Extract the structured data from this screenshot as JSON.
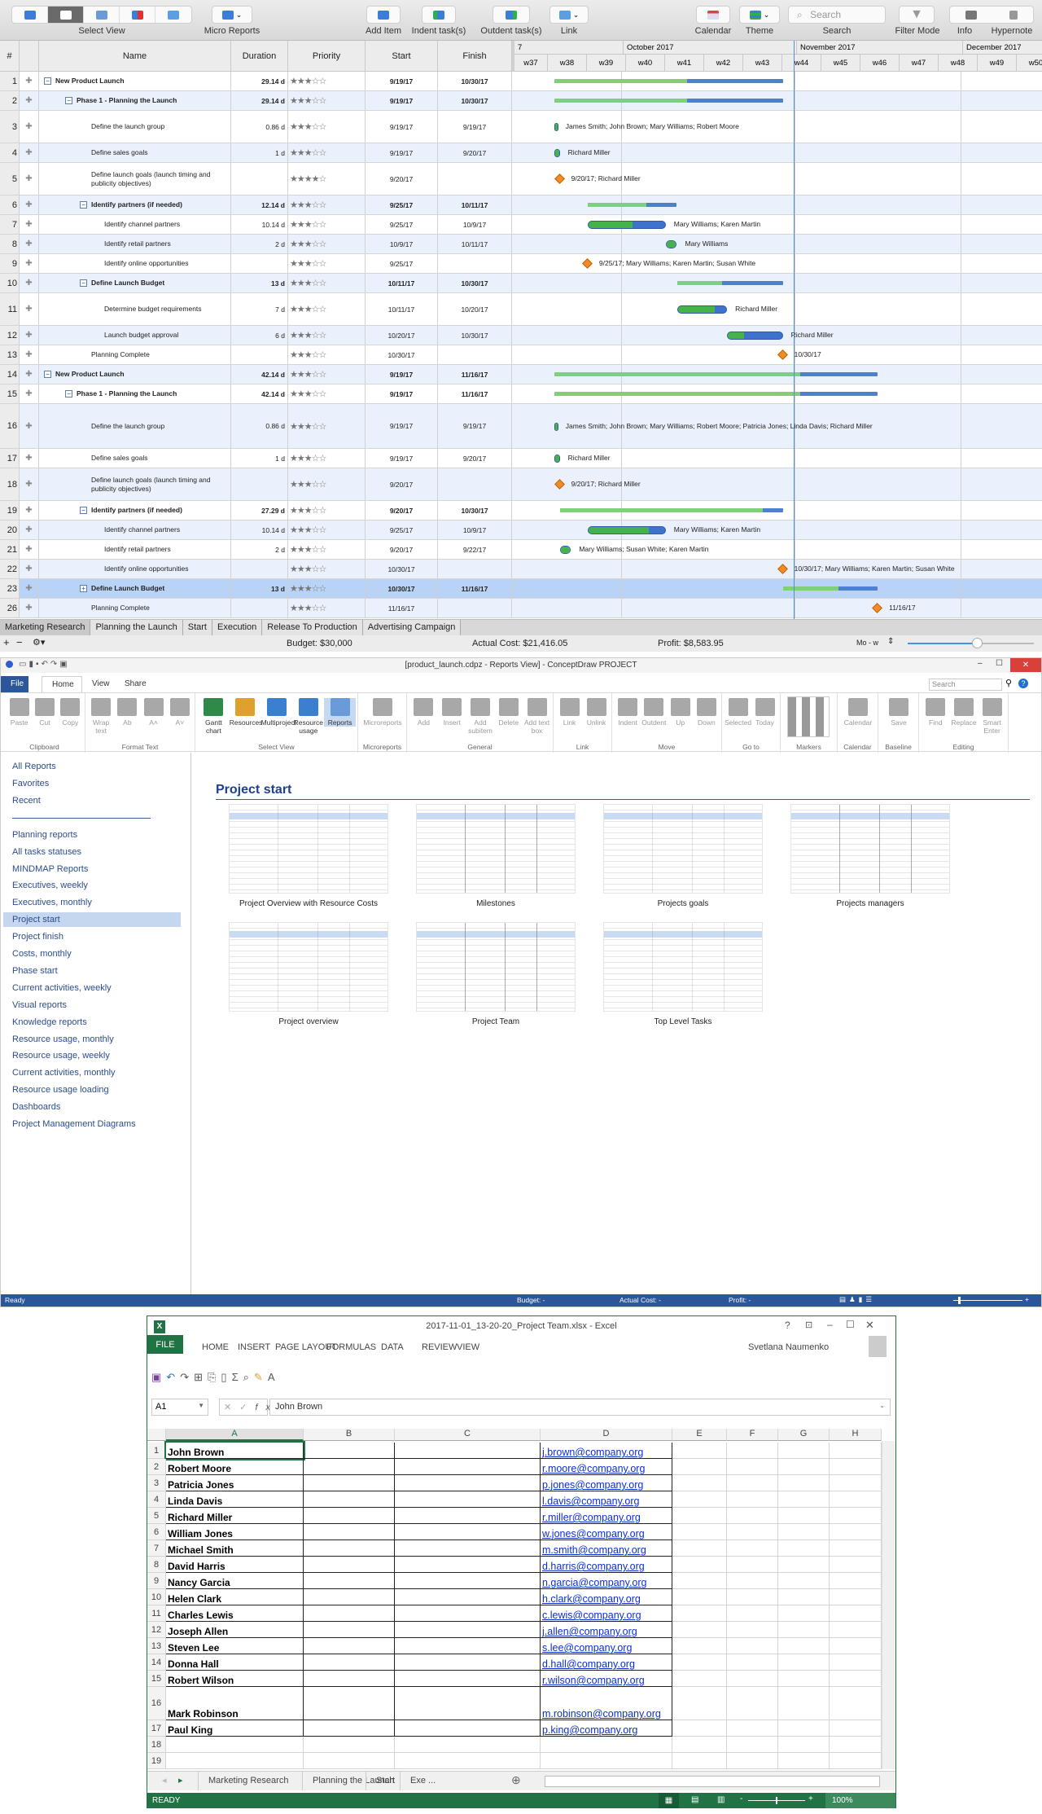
{
  "mac_app": {
    "toolbar": {
      "select_view_label": "Select View",
      "micro_reports_label": "Micro Reports",
      "add_item": "Add Item",
      "indent": "Indent task(s)",
      "outdent": "Outdent task(s)",
      "link": "Link",
      "calendar": "Calendar",
      "theme": "Theme",
      "search_placeholder": "Search",
      "search_label": "Search",
      "filter_mode": "Filter Mode",
      "info": "Info",
      "hypernote": "Hypernote"
    },
    "columns": {
      "num": "#",
      "name": "Name",
      "duration": "Duration",
      "priority": "Priority",
      "start": "Start",
      "finish": "Finish"
    },
    "timeline": {
      "months": [
        "7",
        "October 2017",
        "November 2017",
        "December 2017"
      ],
      "weeks": [
        "w37",
        "w38",
        "w39",
        "w40",
        "w41",
        "w42",
        "w43",
        "w44",
        "w45",
        "w46",
        "w47",
        "w48",
        "w49",
        "w50"
      ],
      "today": "11/1/17"
    },
    "tasks": [
      {
        "n": "1",
        "name": "New Product Launch",
        "lvl": 0,
        "bold": true,
        "tog": "−",
        "dur": "29.14 d",
        "stars": 3,
        "start": "9/19/17",
        "finish": "10/30/17",
        "bar": {
          "type": "summary",
          "from": "9/19/17",
          "to": "10/30/17",
          "progress": 0.58,
          "label": ""
        }
      },
      {
        "n": "2",
        "name": "Phase 1 - Planning the Launch",
        "lvl": 1,
        "bold": true,
        "tog": "−",
        "dur": "29.14 d",
        "stars": 3,
        "start": "9/19/17",
        "finish": "10/30/17",
        "bar": {
          "type": "summary",
          "from": "9/19/17",
          "to": "10/30/17",
          "progress": 0.58,
          "label": ""
        }
      },
      {
        "n": "3",
        "name": "Define the launch group",
        "lvl": 2,
        "bold": false,
        "tog": "",
        "dur": "0.86 d",
        "stars": 3,
        "start": "9/19/17",
        "finish": "9/19/17",
        "bar": {
          "type": "task",
          "from": "9/19/17",
          "to": "9/19/17",
          "progress": 1,
          "label": "James Smith; John Brown; Mary Williams; Robert Moore"
        }
      },
      {
        "n": "4",
        "name": "Define sales goals",
        "lvl": 2,
        "bold": false,
        "tog": "",
        "dur": "1 d",
        "stars": 3,
        "start": "9/19/17",
        "finish": "9/20/17",
        "bar": {
          "type": "task",
          "from": "9/19/17",
          "to": "9/20/17",
          "progress": 1,
          "label": "Richard Miller"
        }
      },
      {
        "n": "5",
        "name": "Define launch goals (launch timing and publicity objectives)",
        "lvl": 2,
        "bold": false,
        "tog": "",
        "dur": "",
        "stars": 4,
        "start": "9/20/17",
        "finish": "",
        "bar": {
          "type": "milestone",
          "from": "9/20/17",
          "to": "9/20/17",
          "progress": 0,
          "label": "9/20/17; Richard Miller"
        }
      },
      {
        "n": "6",
        "name": "Identify partners (if needed)",
        "lvl": 2,
        "bold": true,
        "tog": "−",
        "dur": "12.14 d",
        "stars": 3,
        "start": "9/25/17",
        "finish": "10/11/17",
        "bar": {
          "type": "summary",
          "from": "9/25/17",
          "to": "10/11/17",
          "progress": 0.66,
          "label": ""
        }
      },
      {
        "n": "7",
        "name": "Identify channel partners",
        "lvl": 3,
        "bold": false,
        "tog": "",
        "dur": "10.14 d",
        "stars": 3,
        "start": "9/25/17",
        "finish": "10/9/17",
        "bar": {
          "type": "task",
          "from": "9/25/17",
          "to": "10/9/17",
          "progress": 0.58,
          "label": "Mary Williams; Karen Martin"
        }
      },
      {
        "n": "8",
        "name": "Identify retail partners",
        "lvl": 3,
        "bold": false,
        "tog": "",
        "dur": "2 d",
        "stars": 3,
        "start": "10/9/17",
        "finish": "10/11/17",
        "bar": {
          "type": "task",
          "from": "10/9/17",
          "to": "10/11/17",
          "progress": 1,
          "label": "Mary Williams"
        }
      },
      {
        "n": "9",
        "name": "Identify online opportunities",
        "lvl": 3,
        "bold": false,
        "tog": "",
        "dur": "",
        "stars": 3,
        "start": "9/25/17",
        "finish": "",
        "bar": {
          "type": "milestone",
          "from": "9/25/17",
          "to": "9/25/17",
          "progress": 0,
          "label": "9/25/17; Mary Williams; Karen Martin; Susan White"
        }
      },
      {
        "n": "10",
        "name": "Define Launch Budget",
        "lvl": 2,
        "bold": true,
        "tog": "−",
        "dur": "13 d",
        "stars": 3,
        "start": "10/11/17",
        "finish": "10/30/17",
        "bar": {
          "type": "summary",
          "from": "10/11/17",
          "to": "10/30/17",
          "progress": 0.43,
          "label": ""
        }
      },
      {
        "n": "11",
        "name": "Determine budget requirements",
        "lvl": 3,
        "bold": false,
        "tog": "",
        "dur": "7 d",
        "stars": 3,
        "start": "10/11/17",
        "finish": "10/20/17",
        "bar": {
          "type": "task",
          "from": "10/11/17",
          "to": "10/20/17",
          "progress": 0.77,
          "label": "Richard Miller"
        }
      },
      {
        "n": "12",
        "name": "Launch budget approval",
        "lvl": 3,
        "bold": false,
        "tog": "",
        "dur": "6 d",
        "stars": 3,
        "start": "10/20/17",
        "finish": "10/30/17",
        "bar": {
          "type": "task",
          "from": "10/20/17",
          "to": "10/30/17",
          "progress": 0.3,
          "label": "Richard Miller"
        }
      },
      {
        "n": "13",
        "name": "Planning Complete",
        "lvl": 2,
        "bold": false,
        "tog": "",
        "dur": "",
        "stars": 3,
        "start": "10/30/17",
        "finish": "",
        "bar": {
          "type": "milestone",
          "from": "10/30/17",
          "to": "10/30/17",
          "progress": 0,
          "label": "10/30/17"
        }
      },
      {
        "n": "14",
        "name": "New Product Launch",
        "lvl": 0,
        "bold": true,
        "tog": "−",
        "dur": "42.14 d",
        "stars": 3,
        "start": "9/19/17",
        "finish": "11/16/17",
        "bar": {
          "type": "summary",
          "from": "9/19/17",
          "to": "11/16/17",
          "progress": 0.76,
          "label": ""
        }
      },
      {
        "n": "15",
        "name": "Phase 1 - Planning the Launch",
        "lvl": 1,
        "bold": true,
        "tog": "−",
        "dur": "42.14 d",
        "stars": 3,
        "start": "9/19/17",
        "finish": "11/16/17",
        "bar": {
          "type": "summary",
          "from": "9/19/17",
          "to": "11/16/17",
          "progress": 0.76,
          "label": ""
        }
      },
      {
        "n": "16",
        "name": "Define the launch group",
        "lvl": 2,
        "bold": false,
        "tog": "",
        "dur": "0.86 d",
        "stars": 3,
        "start": "9/19/17",
        "finish": "9/19/17",
        "bar": {
          "type": "task",
          "from": "9/19/17",
          "to": "9/19/17",
          "progress": 1,
          "label": "James Smith; John Brown; Mary Williams; Robert Moore; Patricia Jones; Linda Davis; Richard Miller"
        }
      },
      {
        "n": "17",
        "name": "Define sales goals",
        "lvl": 2,
        "bold": false,
        "tog": "",
        "dur": "1 d",
        "stars": 3,
        "start": "9/19/17",
        "finish": "9/20/17",
        "bar": {
          "type": "task",
          "from": "9/19/17",
          "to": "9/20/17",
          "progress": 1,
          "label": "Richard Miller"
        }
      },
      {
        "n": "18",
        "name": "Define launch goals (launch timing and publicity objectives)",
        "lvl": 2,
        "bold": false,
        "tog": "",
        "dur": "",
        "stars": 3,
        "start": "9/20/17",
        "finish": "",
        "bar": {
          "type": "milestone",
          "from": "9/20/17",
          "to": "9/20/17",
          "progress": 0,
          "label": "9/20/17; Richard Miller"
        }
      },
      {
        "n": "19",
        "name": "Identify partners (if needed)",
        "lvl": 2,
        "bold": true,
        "tog": "−",
        "dur": "27.29 d",
        "stars": 3,
        "start": "9/20/17",
        "finish": "10/30/17",
        "bar": {
          "type": "summary",
          "from": "9/20/17",
          "to": "10/30/17",
          "progress": 0.91,
          "label": ""
        }
      },
      {
        "n": "20",
        "name": "Identify channel partners",
        "lvl": 3,
        "bold": false,
        "tog": "",
        "dur": "10.14 d",
        "stars": 3,
        "start": "9/25/17",
        "finish": "10/9/17",
        "bar": {
          "type": "task",
          "from": "9/25/17",
          "to": "10/9/17",
          "progress": 0.79,
          "label": "Mary Williams; Karen Martin"
        }
      },
      {
        "n": "21",
        "name": "Identify retail partners",
        "lvl": 3,
        "bold": false,
        "tog": "",
        "dur": "2 d",
        "stars": 3,
        "start": "9/20/17",
        "finish": "9/22/17",
        "bar": {
          "type": "task",
          "from": "9/20/17",
          "to": "9/22/17",
          "progress": 1,
          "label": "Mary Williams; Susan White; Karen Martin"
        }
      },
      {
        "n": "22",
        "name": "Identify online opportunities",
        "lvl": 3,
        "bold": false,
        "tog": "",
        "dur": "",
        "stars": 3,
        "start": "10/30/17",
        "finish": "",
        "bar": {
          "type": "milestone",
          "from": "10/30/17",
          "to": "10/30/17",
          "progress": 0,
          "label": "10/30/17; Mary Williams; Karen Martin; Susan White"
        }
      },
      {
        "n": "23",
        "name": "Define Launch Budget",
        "lvl": 2,
        "bold": true,
        "tog": "+",
        "dur": "13 d",
        "stars": 3,
        "start": "10/30/17",
        "finish": "11/16/17",
        "selected": true,
        "bar": {
          "type": "summary",
          "from": "10/30/17",
          "to": "11/16/17",
          "progress": 0.59,
          "label": ""
        }
      },
      {
        "n": "26",
        "name": "Planning Complete",
        "lvl": 2,
        "bold": false,
        "tog": "",
        "dur": "",
        "stars": 3,
        "start": "11/16/17",
        "finish": "",
        "bar": {
          "type": "milestone",
          "from": "11/16/17",
          "to": "11/16/17",
          "progress": 0,
          "label": "11/16/17"
        }
      }
    ],
    "sheet_tabs": [
      "Marketing Research",
      "Planning the Launch",
      "Start",
      "Execution",
      "Release To Production",
      "Advertising Campaign"
    ],
    "active_tab": 0,
    "status": {
      "budget": "Budget: $30,000",
      "actual": "Actual Cost: $21,416.05",
      "profit": "Profit: $8,583.95",
      "scale": "Mo - w",
      "zoom_fraction": 0.55
    },
    "colors": {
      "progress": "#45b24a",
      "remaining": "#3f72cc",
      "milestone": "#f28c28",
      "today": "#4a90e2"
    }
  },
  "conceptdraw": {
    "title": "[product_launch.cdpz - Reports View] - ConceptDraw PROJECT",
    "tabs": [
      "File",
      "Home",
      "View",
      "Share"
    ],
    "search_placeholder": "Search",
    "ribbon": [
      {
        "group": "Clipboard",
        "buttons": [
          "Paste",
          "Cut",
          "Copy"
        ]
      },
      {
        "group": "Format Text",
        "buttons": [
          "Wrap text",
          "Ab",
          "A˄",
          "A˅"
        ]
      },
      {
        "group": "Select View",
        "buttons": [
          "Gantt chart",
          "Resources",
          "Multiproject",
          "Resource usage",
          "Reports"
        ]
      },
      {
        "group": "Microreports",
        "buttons": [
          "Microreports"
        ]
      },
      {
        "group": "General",
        "buttons": [
          "Add",
          "Insert",
          "Add subitem",
          "Delete",
          "Add text box"
        ]
      },
      {
        "group": "Link",
        "buttons": [
          "Link",
          "Unlink"
        ]
      },
      {
        "group": "Move",
        "buttons": [
          "Indent",
          "Outdent",
          "Up",
          "Down"
        ]
      },
      {
        "group": "Go to",
        "buttons": [
          "Selected",
          "Today"
        ]
      },
      {
        "group": "Markers",
        "buttons": []
      },
      {
        "group": "Calendar",
        "buttons": [
          "Calendar"
        ]
      },
      {
        "group": "Baseline",
        "buttons": [
          "Save"
        ]
      },
      {
        "group": "Editing",
        "buttons": [
          "Find",
          "Replace",
          "Smart Enter"
        ]
      }
    ],
    "sidebar": [
      "All Reports",
      "Favorites",
      "Recent",
      "Planning reports",
      "All tasks statuses",
      "MINDMAP Reports",
      "Executives, weekly",
      "Executives, monthly",
      "Project start",
      "Project finish",
      "Costs, monthly",
      "Phase start",
      "Current activities, weekly",
      "Visual reports",
      "Knowledge reports",
      "Resource usage, monthly",
      "Resource usage, weekly",
      "Current activities, monthly",
      "Resource usage loading",
      "Dashboards",
      "Project Management Diagrams"
    ],
    "sidebar_selected": "Project start",
    "heading": "Project start",
    "reports": [
      "Project Overview with Resource Costs",
      "Milestones",
      "Projects goals",
      "Projects managers",
      "Project overview",
      "Project Team",
      "Top Level Tasks"
    ],
    "status": {
      "ready": "Ready",
      "budget": "Budget: -",
      "actual": "Actual Cost: -",
      "profit": "Profit: -"
    }
  },
  "excel": {
    "title": "2017-11-01_13-20-20_Project Team.xlsx - Excel",
    "menu": [
      "FILE",
      "HOME",
      "INSERT",
      "PAGE LAYOUT",
      "FORMULAS",
      "DATA",
      "REVIEW",
      "VIEW"
    ],
    "user": "Svetlana Naumenko",
    "name_box": "A1",
    "formula": "John Brown",
    "columns": [
      "A",
      "B",
      "C",
      "D",
      "E",
      "F",
      "G",
      "H"
    ],
    "rows": [
      {
        "n": "1",
        "name": "John Brown",
        "email": "j.brown@company.org"
      },
      {
        "n": "2",
        "name": "Robert Moore",
        "email": "r.moore@company.org"
      },
      {
        "n": "3",
        "name": "Patricia Jones",
        "email": "p.jones@company.org"
      },
      {
        "n": "4",
        "name": "Linda Davis",
        "email": "l.davis@company.org"
      },
      {
        "n": "5",
        "name": "Richard Miller",
        "email": "r.miller@company.org"
      },
      {
        "n": "6",
        "name": "William Jones",
        "email": "w.jones@company.org"
      },
      {
        "n": "7",
        "name": "Michael Smith",
        "email": "m.smith@company.org"
      },
      {
        "n": "8",
        "name": "David Harris",
        "email": "d.harris@company.org"
      },
      {
        "n": "9",
        "name": "Nancy Garcia",
        "email": "n.garcia@company.org"
      },
      {
        "n": "10",
        "name": "Helen Clark",
        "email": "h.clark@company.org"
      },
      {
        "n": "11",
        "name": "Charles Lewis",
        "email": "c.lewis@company.org"
      },
      {
        "n": "12",
        "name": "Joseph Allen",
        "email": "j.allen@company.org"
      },
      {
        "n": "13",
        "name": "Steven Lee",
        "email": "s.lee@company.org"
      },
      {
        "n": "14",
        "name": "Donna Hall",
        "email": "d.hall@company.org"
      },
      {
        "n": "15",
        "name": "Robert Wilson",
        "email": "r.wilson@company.org"
      },
      {
        "n": "16",
        "name": "Mark Robinson",
        "email": "m.robinson@company.org"
      },
      {
        "n": "17",
        "name": "Paul King",
        "email": "p.king@company.org"
      },
      {
        "n": "18",
        "name": "",
        "email": ""
      },
      {
        "n": "19",
        "name": "",
        "email": ""
      }
    ],
    "sheet_tabs": [
      "Marketing Research",
      "Planning the Launch",
      "Start",
      "Exe ..."
    ],
    "status": "READY",
    "zoom": "100%"
  }
}
